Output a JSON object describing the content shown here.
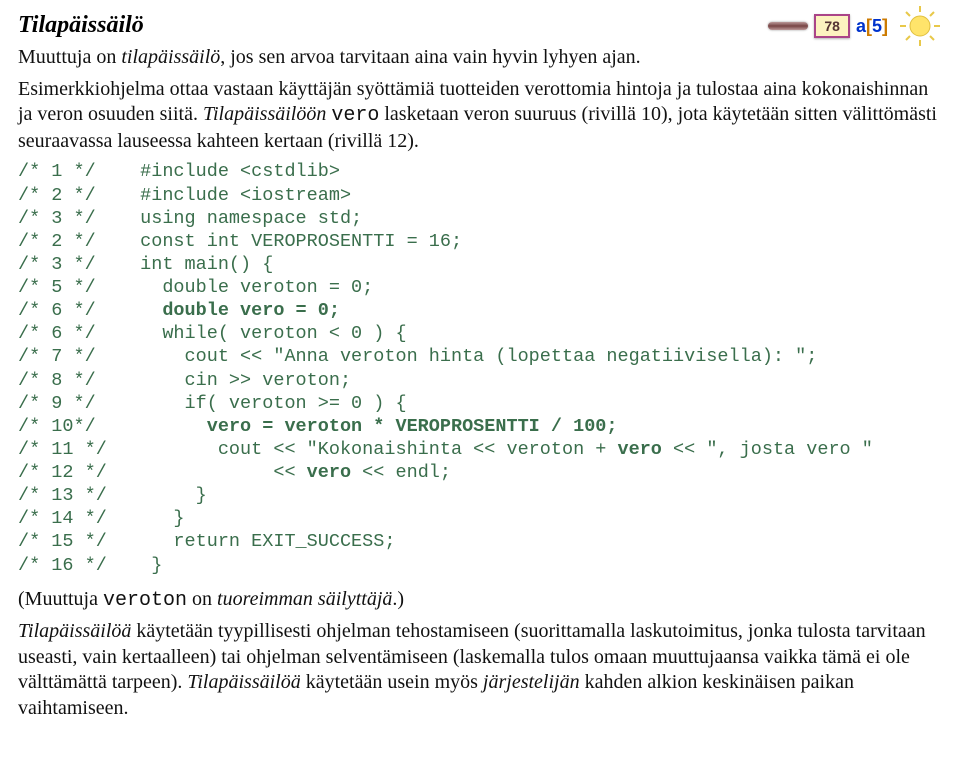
{
  "header": {
    "title": "Tilapäissäilö",
    "page_number": "78",
    "ref": {
      "a": "a",
      "open": "[",
      "num": "5",
      "close": "]"
    }
  },
  "p1": {
    "t1": "Muuttuja on ",
    "t2": "tilapäissäilö",
    "t3": ", jos sen arvoa tarvitaan aina vain hyvin lyhyen ajan."
  },
  "p2": {
    "t1": "Esimerkkiohjelma ottaa vastaan käyttäjän syöttämiä tuotteiden verottomia hintoja ja tulostaa aina kokonaishinnan ja veron osuuden siitä. ",
    "t2": "Tilapäissäilöön",
    "t3": " ",
    "t4": "vero",
    "t5": " lasketaan veron suuruus (rivillä 10), jota käytetään sitten välittömästi seuraavassa lauseessa kahteen kertaan (rivillä 12)."
  },
  "code": {
    "l1a": "/* 1 */    #include <cstdlib>",
    "l2a": "/* 2 */    #include <iostream>",
    "l3a": "/* 3 */    using namespace std;",
    "l4a": "/* 2 */    const int VEROPROSENTTI = 16;",
    "l5a": "/* 3 */    int main() {",
    "l6a": "/* 5 */      double veroton = 0;",
    "l7a": "/* 6 */      ",
    "l7b": "double vero = 0;",
    "l8a": "/* 6 */      while( veroton < 0 ) {",
    "l9a": "/* 7 */        cout << \"Anna veroton hinta (lopettaa negatiivisella): \";",
    "l10a": "/* 8 */        cin >> veroton;",
    "l11a": "/* 9 */        if( veroton >= 0 ) {",
    "l12a": "/* 10*/          ",
    "l12b": "vero = veroton * VEROPROSENTTI / 100;",
    "l13a": "/* 11 */          cout << \"Kokonaishinta << veroton + ",
    "l13b": "vero",
    "l13c": " << \", josta vero \"",
    "l14a": "/* 12 */               << ",
    "l14b": "vero",
    "l14c": " << endl;",
    "l15a": "/* 13 */        }",
    "l16a": "/* 14 */      }",
    "l17a": "/* 15 */      return EXIT_SUCCESS;",
    "l18a": "/* 16 */    }"
  },
  "p3": {
    "t1": "(Muuttuja ",
    "t2": "veroton",
    "t3": " on ",
    "t4": "tuoreimman säilyttäjä",
    "t5": ".)"
  },
  "p4": {
    "t1": "Tilapäissäilöä",
    "t2": " käytetään tyypillisesti ohjelman tehostamiseen (suorittamalla laskutoimitus, jonka tulosta tarvitaan useasti, vain kertaalleen) tai ohjelman selventämiseen (laskemalla tulos omaan muuttujaansa vaikka tämä ei ole välttämättä tarpeen). ",
    "t3": "Tilapäissäilöä",
    "t4": " käytetään usein myös ",
    "t5": "järjestelijän",
    "t6": " kahden alkion keskinäisen paikan vaihtamiseen."
  }
}
